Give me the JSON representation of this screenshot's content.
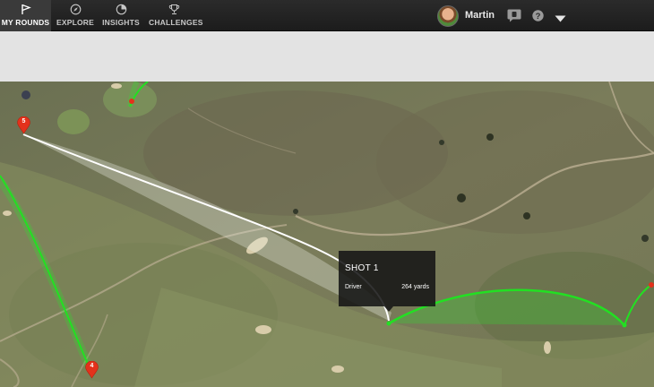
{
  "nav": {
    "tabs": [
      {
        "label": "MY ROUNDS",
        "icon": "flag-icon",
        "active": true
      },
      {
        "label": "EXPLORE",
        "icon": "compass-icon",
        "active": false
      },
      {
        "label": "INSIGHTS",
        "icon": "pie-chart-icon",
        "active": false
      },
      {
        "label": "CHALLENGES",
        "icon": "trophy-icon",
        "active": false
      }
    ],
    "user": {
      "name": "Martin"
    },
    "messages_icon": "chat-icon",
    "help_icon": "question-icon",
    "menu_icon": "caret-down-icon"
  },
  "map": {
    "shot_tooltip": {
      "title": "SHOT 1",
      "club": "Driver",
      "distance": "264 yards"
    },
    "hole_markers": [
      {
        "number": "5"
      },
      {
        "number": "4"
      }
    ]
  },
  "colors": {
    "nav_bg": "#1c1c1c",
    "nav_active": "#3a3a3a",
    "band": "#e3e3e3",
    "shot_line": "#ffffff",
    "approach_line": "#22e022",
    "marker": "#e3321c"
  }
}
